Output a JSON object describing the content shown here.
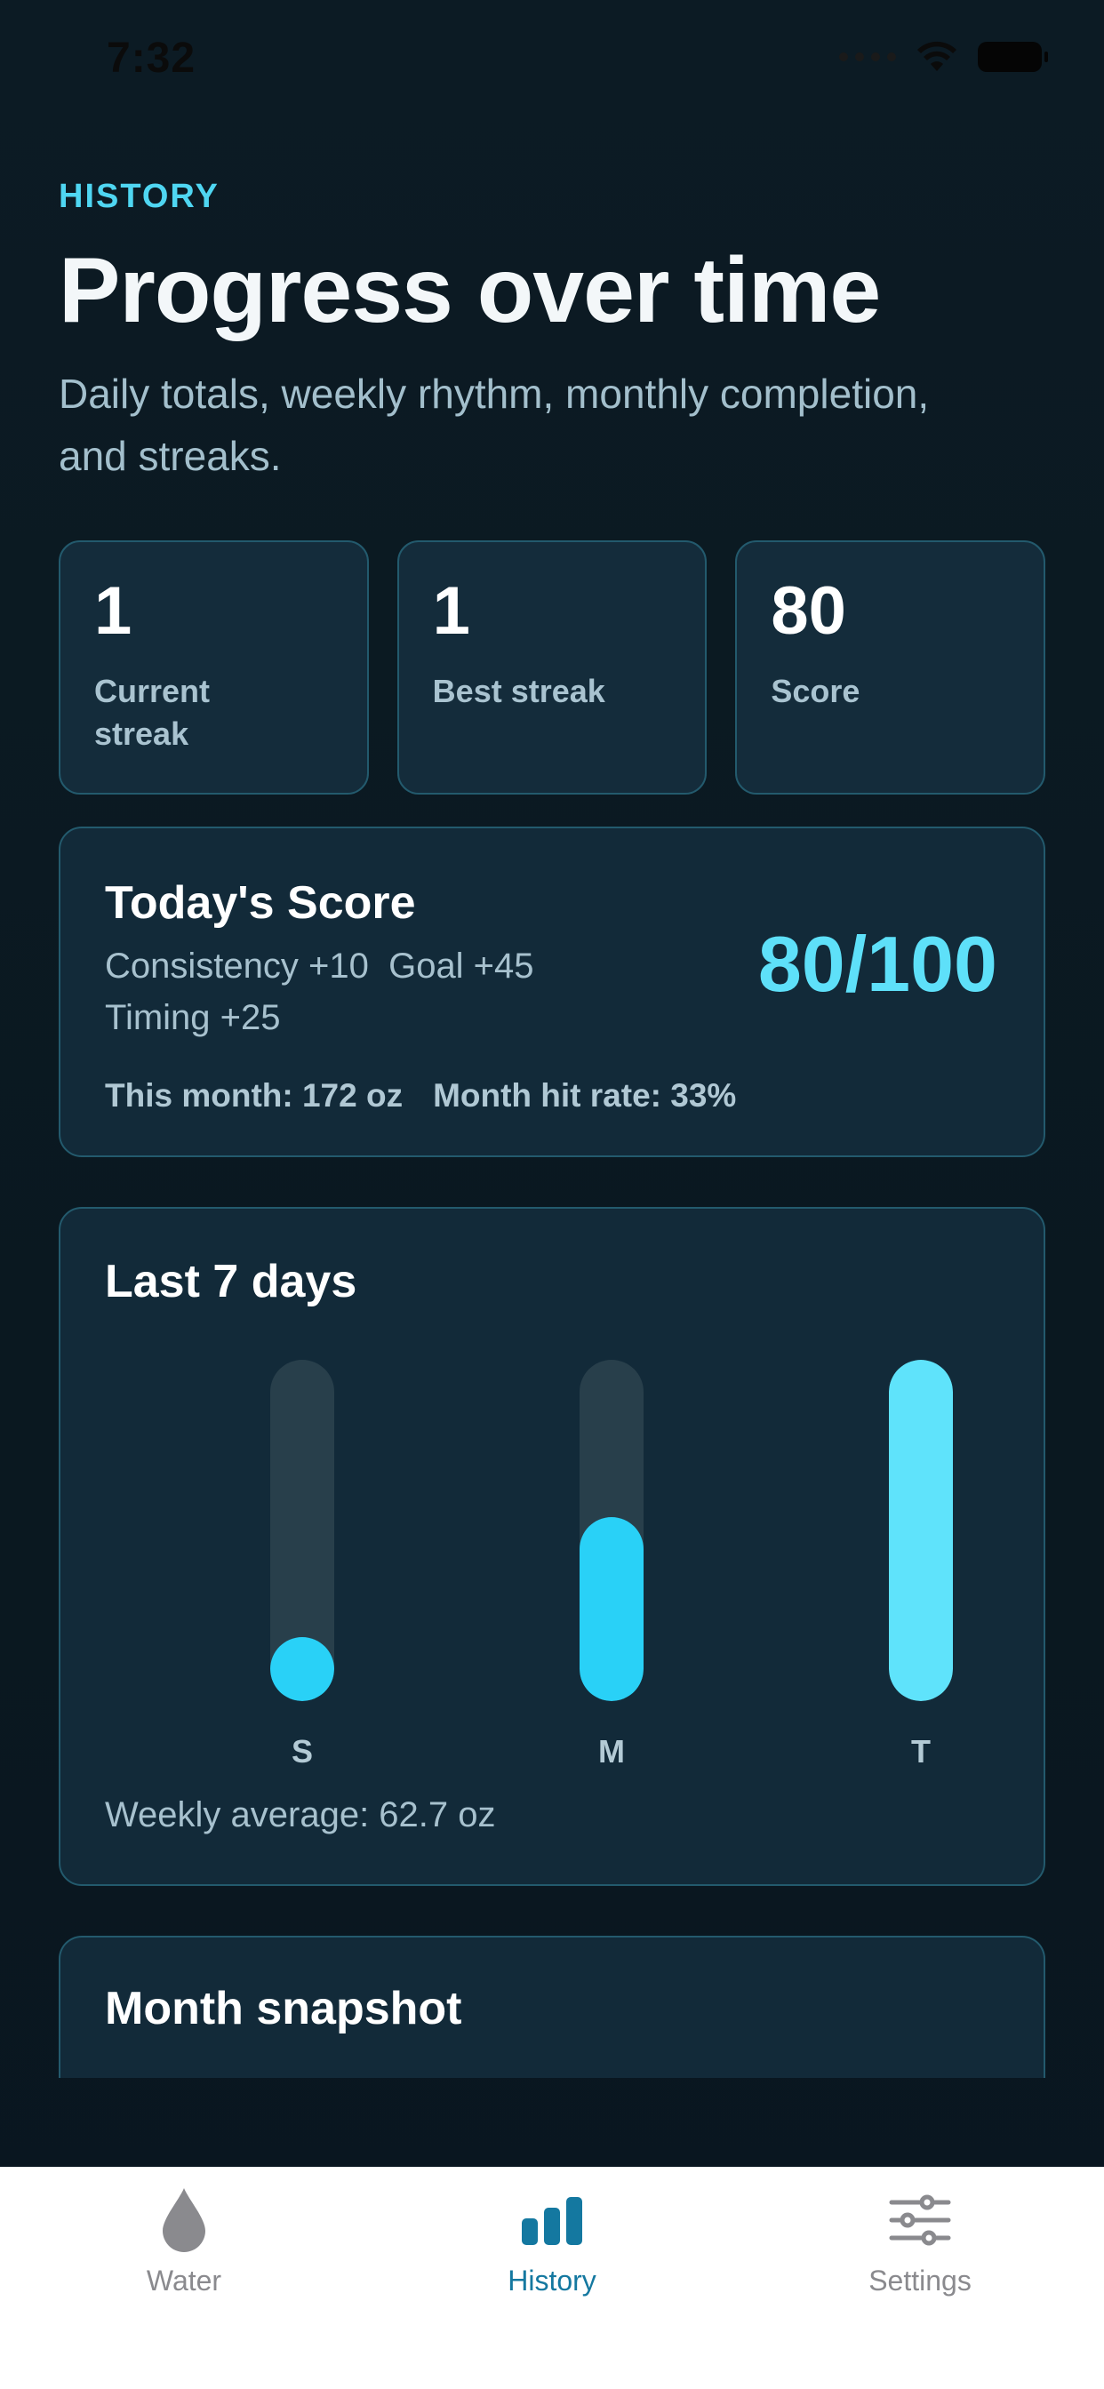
{
  "status_bar": {
    "time": "7:32",
    "icons": [
      "signal-icon",
      "wifi-icon",
      "battery-icon"
    ]
  },
  "header": {
    "eyebrow": "HISTORY",
    "title": "Progress over time",
    "subtitle": "Daily totals, weekly rhythm, monthly completion, and streaks."
  },
  "stats": [
    {
      "value": "1",
      "label": "Current streak"
    },
    {
      "value": "1",
      "label": "Best streak"
    },
    {
      "value": "80",
      "label": "Score"
    }
  ],
  "score_card": {
    "title": "Today's Score",
    "consistency": "Consistency +10",
    "goal": "Goal +45",
    "timing": "Timing +25",
    "score": "80/100",
    "month_total": "This month: 172 oz",
    "month_hit_rate": "Month hit rate: 33%"
  },
  "week_card": {
    "title": "Last 7 days",
    "weekly_average": "Weekly average: 62.7 oz"
  },
  "chart_data": {
    "type": "bar",
    "title": "Last 7 days",
    "categories": [
      "S",
      "M",
      "T"
    ],
    "values": [
      0.18,
      0.54,
      1.0
    ],
    "value_unit": "fraction of daily goal",
    "colors": [
      "#29d1f7",
      "#29d1f7",
      "#5fe3fb"
    ],
    "ylim": [
      0,
      1
    ],
    "grid": false
  },
  "month_card": {
    "title": "Month snapshot"
  },
  "tabs": [
    {
      "label": "Water",
      "icon": "drop-icon",
      "active": false
    },
    {
      "label": "History",
      "icon": "bar-chart-icon",
      "active": true
    },
    {
      "label": "Settings",
      "icon": "sliders-icon",
      "active": false
    }
  ],
  "colors": {
    "accent": "#4fd6f2",
    "score": "#5ee0f9",
    "bar_fill": "#29d1f7",
    "bar_track": "#283f4b",
    "tab_active": "#1478a0",
    "tab_inactive": "#8a8a8e"
  }
}
